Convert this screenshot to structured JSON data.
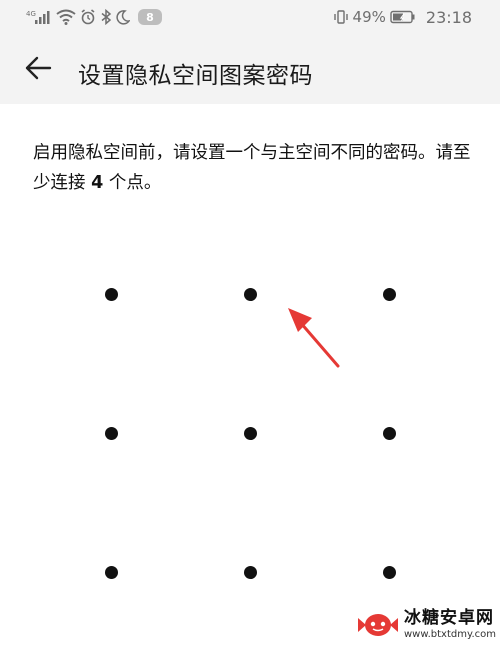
{
  "status_bar": {
    "network_label": "4G",
    "notification_count": "8",
    "battery_percent": "49%",
    "time": "23:18",
    "icons": [
      "signal-icon",
      "wifi-icon",
      "alarm-icon",
      "bluetooth-icon",
      "moon-icon",
      "vibrate-icon",
      "battery-icon"
    ]
  },
  "header": {
    "title": "设置隐私空间图案密码",
    "back_icon": "arrow-left-icon"
  },
  "instruction": {
    "text_before": "启用隐私空间前，请设置一个与主空间不同的密码。请至少连接 ",
    "min_points": "4",
    "text_after": " 个点。"
  },
  "pattern": {
    "rows": 3,
    "cols": 3,
    "dot_color": "#111111"
  },
  "annotation": {
    "arrow_color": "#e53935"
  },
  "watermark": {
    "title": "冰糖安卓网",
    "url": "www.btxtdmy.com"
  }
}
